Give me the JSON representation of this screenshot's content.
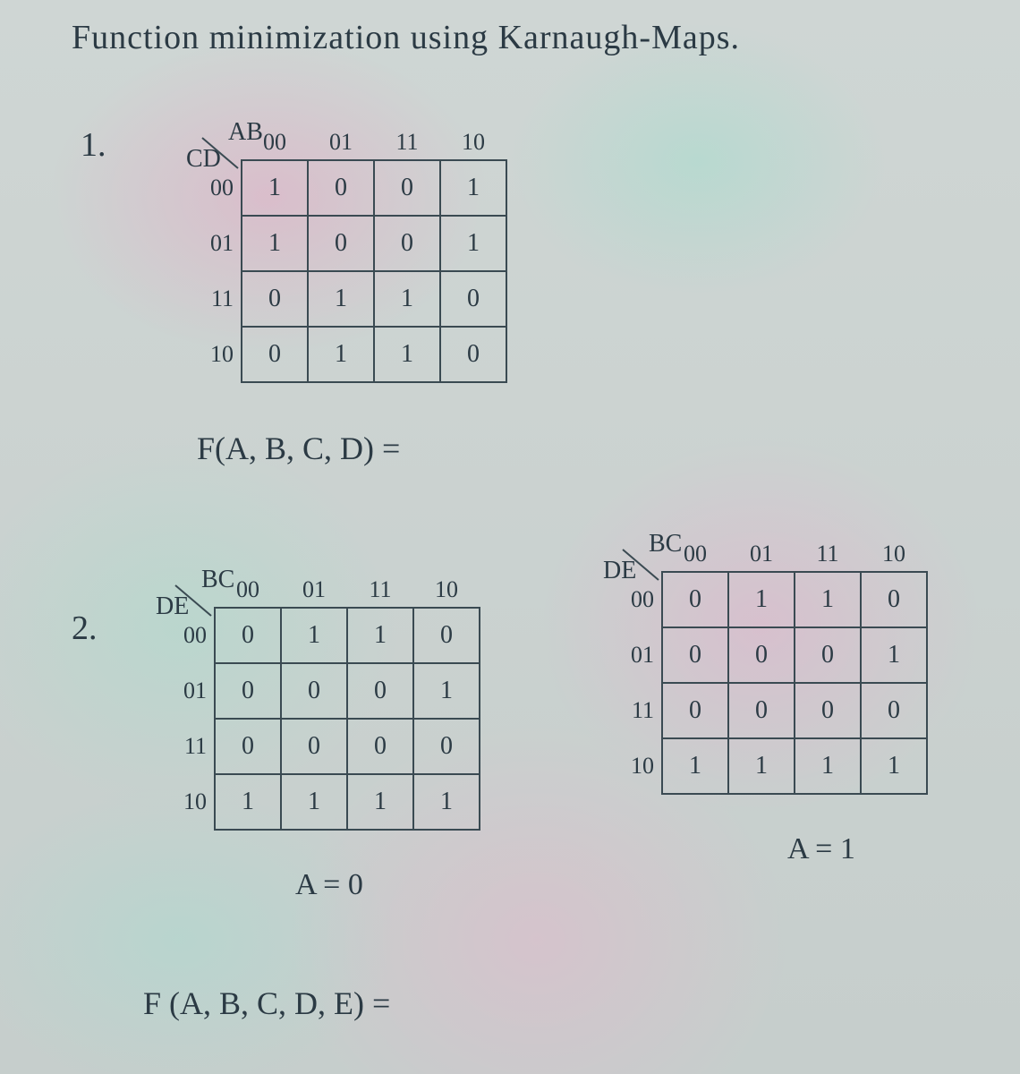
{
  "title": "Function minimization using Karnaugh-Maps.",
  "problems": {
    "p1": {
      "number": "1.",
      "axis_top": "AB",
      "axis_left": "CD",
      "col_headers": [
        "00",
        "01",
        "11",
        "10"
      ],
      "row_headers": [
        "00",
        "01",
        "11",
        "10"
      ],
      "cells": [
        [
          "1",
          "0",
          "0",
          "1"
        ],
        [
          "1",
          "0",
          "0",
          "1"
        ],
        [
          "0",
          "1",
          "1",
          "0"
        ],
        [
          "0",
          "1",
          "1",
          "0"
        ]
      ],
      "formula": "F(A, B, C, D)  ="
    },
    "p2": {
      "number": "2.",
      "map_a": {
        "axis_top": "BC",
        "axis_left": "DE",
        "col_headers": [
          "00",
          "01",
          "11",
          "10"
        ],
        "row_headers": [
          "00",
          "01",
          "11",
          "10"
        ],
        "cells": [
          [
            "0",
            "1",
            "1",
            "0"
          ],
          [
            "0",
            "0",
            "0",
            "1"
          ],
          [
            "0",
            "0",
            "0",
            "0"
          ],
          [
            "1",
            "1",
            "1",
            "1"
          ]
        ],
        "label": "A = 0"
      },
      "map_b": {
        "axis_top": "BC",
        "axis_left": "DE",
        "col_headers": [
          "00",
          "01",
          "11",
          "10"
        ],
        "row_headers": [
          "00",
          "01",
          "11",
          "10"
        ],
        "cells": [
          [
            "0",
            "1",
            "1",
            "0"
          ],
          [
            "0",
            "0",
            "0",
            "1"
          ],
          [
            "0",
            "0",
            "0",
            "0"
          ],
          [
            "1",
            "1",
            "1",
            "1"
          ]
        ],
        "label": "A = 1"
      },
      "formula": "F (A, B, C, D, E) ="
    }
  },
  "chart_data": [
    {
      "type": "table",
      "title": "K-map 1 (AB vs CD)",
      "col_vars": "AB",
      "row_vars": "CD",
      "cols": [
        "00",
        "01",
        "11",
        "10"
      ],
      "rows": [
        "00",
        "01",
        "11",
        "10"
      ],
      "values": [
        [
          1,
          0,
          0,
          1
        ],
        [
          1,
          0,
          0,
          1
        ],
        [
          0,
          1,
          1,
          0
        ],
        [
          0,
          1,
          1,
          0
        ]
      ]
    },
    {
      "type": "table",
      "title": "K-map 2 A=0 (BC vs DE)",
      "col_vars": "BC",
      "row_vars": "DE",
      "cols": [
        "00",
        "01",
        "11",
        "10"
      ],
      "rows": [
        "00",
        "01",
        "11",
        "10"
      ],
      "values": [
        [
          0,
          1,
          1,
          0
        ],
        [
          0,
          0,
          0,
          1
        ],
        [
          0,
          0,
          0,
          0
        ],
        [
          1,
          1,
          1,
          1
        ]
      ]
    },
    {
      "type": "table",
      "title": "K-map 2 A=1 (BC vs DE)",
      "col_vars": "BC",
      "row_vars": "DE",
      "cols": [
        "00",
        "01",
        "11",
        "10"
      ],
      "rows": [
        "00",
        "01",
        "11",
        "10"
      ],
      "values": [
        [
          0,
          1,
          1,
          0
        ],
        [
          0,
          0,
          0,
          1
        ],
        [
          0,
          0,
          0,
          0
        ],
        [
          1,
          1,
          1,
          1
        ]
      ]
    }
  ]
}
